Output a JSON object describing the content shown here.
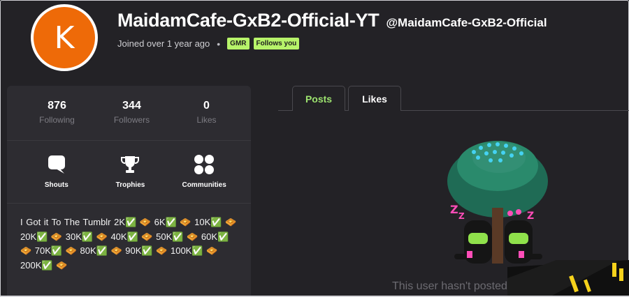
{
  "profile": {
    "avatar_letter": "K",
    "avatar_color": "#ee6a08",
    "display_name": "MaidamCafe-GxB2-Official-YT",
    "username": "@MaidamCafe-GxB2-Official",
    "joined": "Joined over 1 year ago",
    "separator": "•",
    "badges": [
      "GMR",
      "Follows you"
    ],
    "badge_color": "#b7f36a"
  },
  "stats": [
    {
      "value": "876",
      "label": "Following"
    },
    {
      "value": "344",
      "label": "Followers"
    },
    {
      "value": "0",
      "label": "Likes"
    }
  ],
  "actions": [
    {
      "label": "Shouts",
      "icon": "speech-bubble-icon"
    },
    {
      "label": "Trophies",
      "icon": "trophy-icon"
    },
    {
      "label": "Communities",
      "icon": "four-dots-icon"
    }
  ],
  "bio": "I Got it To The Tumblr 2K✅ 🧇 6K✅ 🧇 10K✅ 🧇 20K✅ 🧇 30K✅ 🧇 40K✅ 🧇 50K✅ 🧇 60K✅ 🧇 70K✅ 🧇 80K✅ 🧇 90K✅ 🧇 100K✅ 🧇 200K✅ 🧇",
  "tabs": [
    {
      "label": "Posts",
      "active": true
    },
    {
      "label": "Likes",
      "active": false
    }
  ],
  "tab_active_color": "#9de36f",
  "empty_state": {
    "text": "This user hasn't posted",
    "illustration": "sleeping-under-tree-illustration"
  },
  "colors": {
    "background": "#232226",
    "panel": "#2d2c31"
  }
}
